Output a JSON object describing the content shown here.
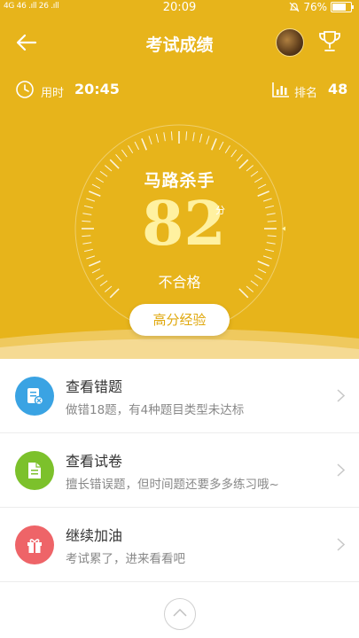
{
  "status_bar": {
    "left": "4G 46 .ıll 26 .ıll",
    "time": "20:09",
    "battery": "76%",
    "battery_level": 0.76
  },
  "header": {
    "title": "考试成绩",
    "icons": [
      "back-arrow-icon",
      "avatar",
      "trophy-icon"
    ]
  },
  "stats": {
    "time_label": "用时",
    "time_value": "20:45",
    "rank_label": "排名",
    "rank_value": "48"
  },
  "gauge": {
    "title": "马路杀手",
    "score": "82",
    "unit": "分",
    "result": "不合格",
    "score_fraction": 0.82
  },
  "experience_button": "高分经验",
  "actions": [
    {
      "title": "查看错题",
      "subtitle": "做错18题，有4种题目类型未达标",
      "color": "#3aa3e3",
      "icon": "wrong-questions-icon"
    },
    {
      "title": "查看试卷",
      "subtitle": "擅长错误题，但时间题还要多多练习哦~",
      "color": "#7cc12b",
      "icon": "exam-paper-icon"
    },
    {
      "title": "继续加油",
      "subtitle": "考试累了，进来看看吧",
      "color": "#ee6468",
      "icon": "gift-icon"
    }
  ]
}
